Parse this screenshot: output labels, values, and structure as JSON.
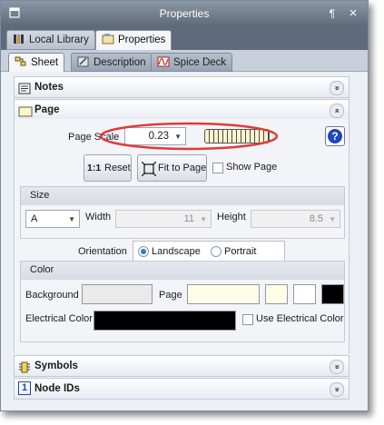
{
  "window": {
    "title": "Properties",
    "pin_glyph": "¶",
    "close_glyph": "×"
  },
  "tabs": [
    {
      "label": "Local Library",
      "icon": "library-icon",
      "active": false
    },
    {
      "label": "Properties",
      "icon": "properties-icon",
      "active": true
    }
  ],
  "subtabs": [
    {
      "label": "Sheet",
      "icon": "sheet-icon",
      "active": true
    },
    {
      "label": "Description",
      "icon": "description-icon",
      "active": false
    },
    {
      "label": "Spice Deck",
      "icon": "spice-deck-icon",
      "active": false
    }
  ],
  "sections": {
    "notes": {
      "label": "Notes",
      "chev": "»"
    },
    "page": {
      "label": "Page",
      "chev": "«"
    },
    "symbols": {
      "label": "Symbols",
      "chev": "»"
    },
    "node_ids": {
      "label": "Node IDs",
      "chev": "»",
      "icon_text": "1"
    }
  },
  "page": {
    "scale_label": "Page Scale",
    "scale_value": "0.23",
    "reset_icon_text": "1:1",
    "reset_label": "Reset",
    "fit_label": "Fit to Page",
    "show_page_label": "Show Page",
    "show_page_checked": false,
    "help_glyph": "?",
    "size": {
      "header": "Size",
      "value": "A",
      "width_label": "Width",
      "width_value": "11",
      "height_label": "Height",
      "height_value": "8.5"
    },
    "orientation": {
      "label": "Orientation",
      "options": [
        "Landscape",
        "Portrait"
      ],
      "selected": "Landscape"
    },
    "color": {
      "header": "Color",
      "background_label": "Background",
      "page_label": "Page",
      "electrical_label": "Electrical Color",
      "use_electrical_label": "Use Electrical Color",
      "use_electrical_checked": false,
      "colors": {
        "background": "#eaeaea",
        "page": "#fffde8",
        "page_alt1": "#fffde8",
        "page_alt2": "#ffffff",
        "page_alt3": "#000000",
        "electrical": "#000000"
      }
    }
  },
  "annotation_color": "#e03a3a",
  "accent_color": "#1f46b8"
}
